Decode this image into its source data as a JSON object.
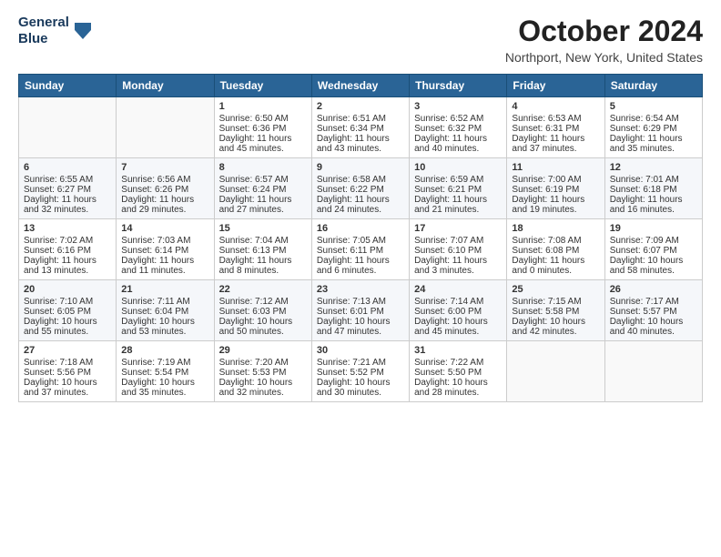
{
  "header": {
    "logo_line1": "General",
    "logo_line2": "Blue",
    "month": "October 2024",
    "location": "Northport, New York, United States"
  },
  "weekdays": [
    "Sunday",
    "Monday",
    "Tuesday",
    "Wednesday",
    "Thursday",
    "Friday",
    "Saturday"
  ],
  "weeks": [
    [
      {
        "day": "",
        "sunrise": "",
        "sunset": "",
        "daylight": ""
      },
      {
        "day": "",
        "sunrise": "",
        "sunset": "",
        "daylight": ""
      },
      {
        "day": "1",
        "sunrise": "Sunrise: 6:50 AM",
        "sunset": "Sunset: 6:36 PM",
        "daylight": "Daylight: 11 hours and 45 minutes."
      },
      {
        "day": "2",
        "sunrise": "Sunrise: 6:51 AM",
        "sunset": "Sunset: 6:34 PM",
        "daylight": "Daylight: 11 hours and 43 minutes."
      },
      {
        "day": "3",
        "sunrise": "Sunrise: 6:52 AM",
        "sunset": "Sunset: 6:32 PM",
        "daylight": "Daylight: 11 hours and 40 minutes."
      },
      {
        "day": "4",
        "sunrise": "Sunrise: 6:53 AM",
        "sunset": "Sunset: 6:31 PM",
        "daylight": "Daylight: 11 hours and 37 minutes."
      },
      {
        "day": "5",
        "sunrise": "Sunrise: 6:54 AM",
        "sunset": "Sunset: 6:29 PM",
        "daylight": "Daylight: 11 hours and 35 minutes."
      }
    ],
    [
      {
        "day": "6",
        "sunrise": "Sunrise: 6:55 AM",
        "sunset": "Sunset: 6:27 PM",
        "daylight": "Daylight: 11 hours and 32 minutes."
      },
      {
        "day": "7",
        "sunrise": "Sunrise: 6:56 AM",
        "sunset": "Sunset: 6:26 PM",
        "daylight": "Daylight: 11 hours and 29 minutes."
      },
      {
        "day": "8",
        "sunrise": "Sunrise: 6:57 AM",
        "sunset": "Sunset: 6:24 PM",
        "daylight": "Daylight: 11 hours and 27 minutes."
      },
      {
        "day": "9",
        "sunrise": "Sunrise: 6:58 AM",
        "sunset": "Sunset: 6:22 PM",
        "daylight": "Daylight: 11 hours and 24 minutes."
      },
      {
        "day": "10",
        "sunrise": "Sunrise: 6:59 AM",
        "sunset": "Sunset: 6:21 PM",
        "daylight": "Daylight: 11 hours and 21 minutes."
      },
      {
        "day": "11",
        "sunrise": "Sunrise: 7:00 AM",
        "sunset": "Sunset: 6:19 PM",
        "daylight": "Daylight: 11 hours and 19 minutes."
      },
      {
        "day": "12",
        "sunrise": "Sunrise: 7:01 AM",
        "sunset": "Sunset: 6:18 PM",
        "daylight": "Daylight: 11 hours and 16 minutes."
      }
    ],
    [
      {
        "day": "13",
        "sunrise": "Sunrise: 7:02 AM",
        "sunset": "Sunset: 6:16 PM",
        "daylight": "Daylight: 11 hours and 13 minutes."
      },
      {
        "day": "14",
        "sunrise": "Sunrise: 7:03 AM",
        "sunset": "Sunset: 6:14 PM",
        "daylight": "Daylight: 11 hours and 11 minutes."
      },
      {
        "day": "15",
        "sunrise": "Sunrise: 7:04 AM",
        "sunset": "Sunset: 6:13 PM",
        "daylight": "Daylight: 11 hours and 8 minutes."
      },
      {
        "day": "16",
        "sunrise": "Sunrise: 7:05 AM",
        "sunset": "Sunset: 6:11 PM",
        "daylight": "Daylight: 11 hours and 6 minutes."
      },
      {
        "day": "17",
        "sunrise": "Sunrise: 7:07 AM",
        "sunset": "Sunset: 6:10 PM",
        "daylight": "Daylight: 11 hours and 3 minutes."
      },
      {
        "day": "18",
        "sunrise": "Sunrise: 7:08 AM",
        "sunset": "Sunset: 6:08 PM",
        "daylight": "Daylight: 11 hours and 0 minutes."
      },
      {
        "day": "19",
        "sunrise": "Sunrise: 7:09 AM",
        "sunset": "Sunset: 6:07 PM",
        "daylight": "Daylight: 10 hours and 58 minutes."
      }
    ],
    [
      {
        "day": "20",
        "sunrise": "Sunrise: 7:10 AM",
        "sunset": "Sunset: 6:05 PM",
        "daylight": "Daylight: 10 hours and 55 minutes."
      },
      {
        "day": "21",
        "sunrise": "Sunrise: 7:11 AM",
        "sunset": "Sunset: 6:04 PM",
        "daylight": "Daylight: 10 hours and 53 minutes."
      },
      {
        "day": "22",
        "sunrise": "Sunrise: 7:12 AM",
        "sunset": "Sunset: 6:03 PM",
        "daylight": "Daylight: 10 hours and 50 minutes."
      },
      {
        "day": "23",
        "sunrise": "Sunrise: 7:13 AM",
        "sunset": "Sunset: 6:01 PM",
        "daylight": "Daylight: 10 hours and 47 minutes."
      },
      {
        "day": "24",
        "sunrise": "Sunrise: 7:14 AM",
        "sunset": "Sunset: 6:00 PM",
        "daylight": "Daylight: 10 hours and 45 minutes."
      },
      {
        "day": "25",
        "sunrise": "Sunrise: 7:15 AM",
        "sunset": "Sunset: 5:58 PM",
        "daylight": "Daylight: 10 hours and 42 minutes."
      },
      {
        "day": "26",
        "sunrise": "Sunrise: 7:17 AM",
        "sunset": "Sunset: 5:57 PM",
        "daylight": "Daylight: 10 hours and 40 minutes."
      }
    ],
    [
      {
        "day": "27",
        "sunrise": "Sunrise: 7:18 AM",
        "sunset": "Sunset: 5:56 PM",
        "daylight": "Daylight: 10 hours and 37 minutes."
      },
      {
        "day": "28",
        "sunrise": "Sunrise: 7:19 AM",
        "sunset": "Sunset: 5:54 PM",
        "daylight": "Daylight: 10 hours and 35 minutes."
      },
      {
        "day": "29",
        "sunrise": "Sunrise: 7:20 AM",
        "sunset": "Sunset: 5:53 PM",
        "daylight": "Daylight: 10 hours and 32 minutes."
      },
      {
        "day": "30",
        "sunrise": "Sunrise: 7:21 AM",
        "sunset": "Sunset: 5:52 PM",
        "daylight": "Daylight: 10 hours and 30 minutes."
      },
      {
        "day": "31",
        "sunrise": "Sunrise: 7:22 AM",
        "sunset": "Sunset: 5:50 PM",
        "daylight": "Daylight: 10 hours and 28 minutes."
      },
      {
        "day": "",
        "sunrise": "",
        "sunset": "",
        "daylight": ""
      },
      {
        "day": "",
        "sunrise": "",
        "sunset": "",
        "daylight": ""
      }
    ]
  ]
}
